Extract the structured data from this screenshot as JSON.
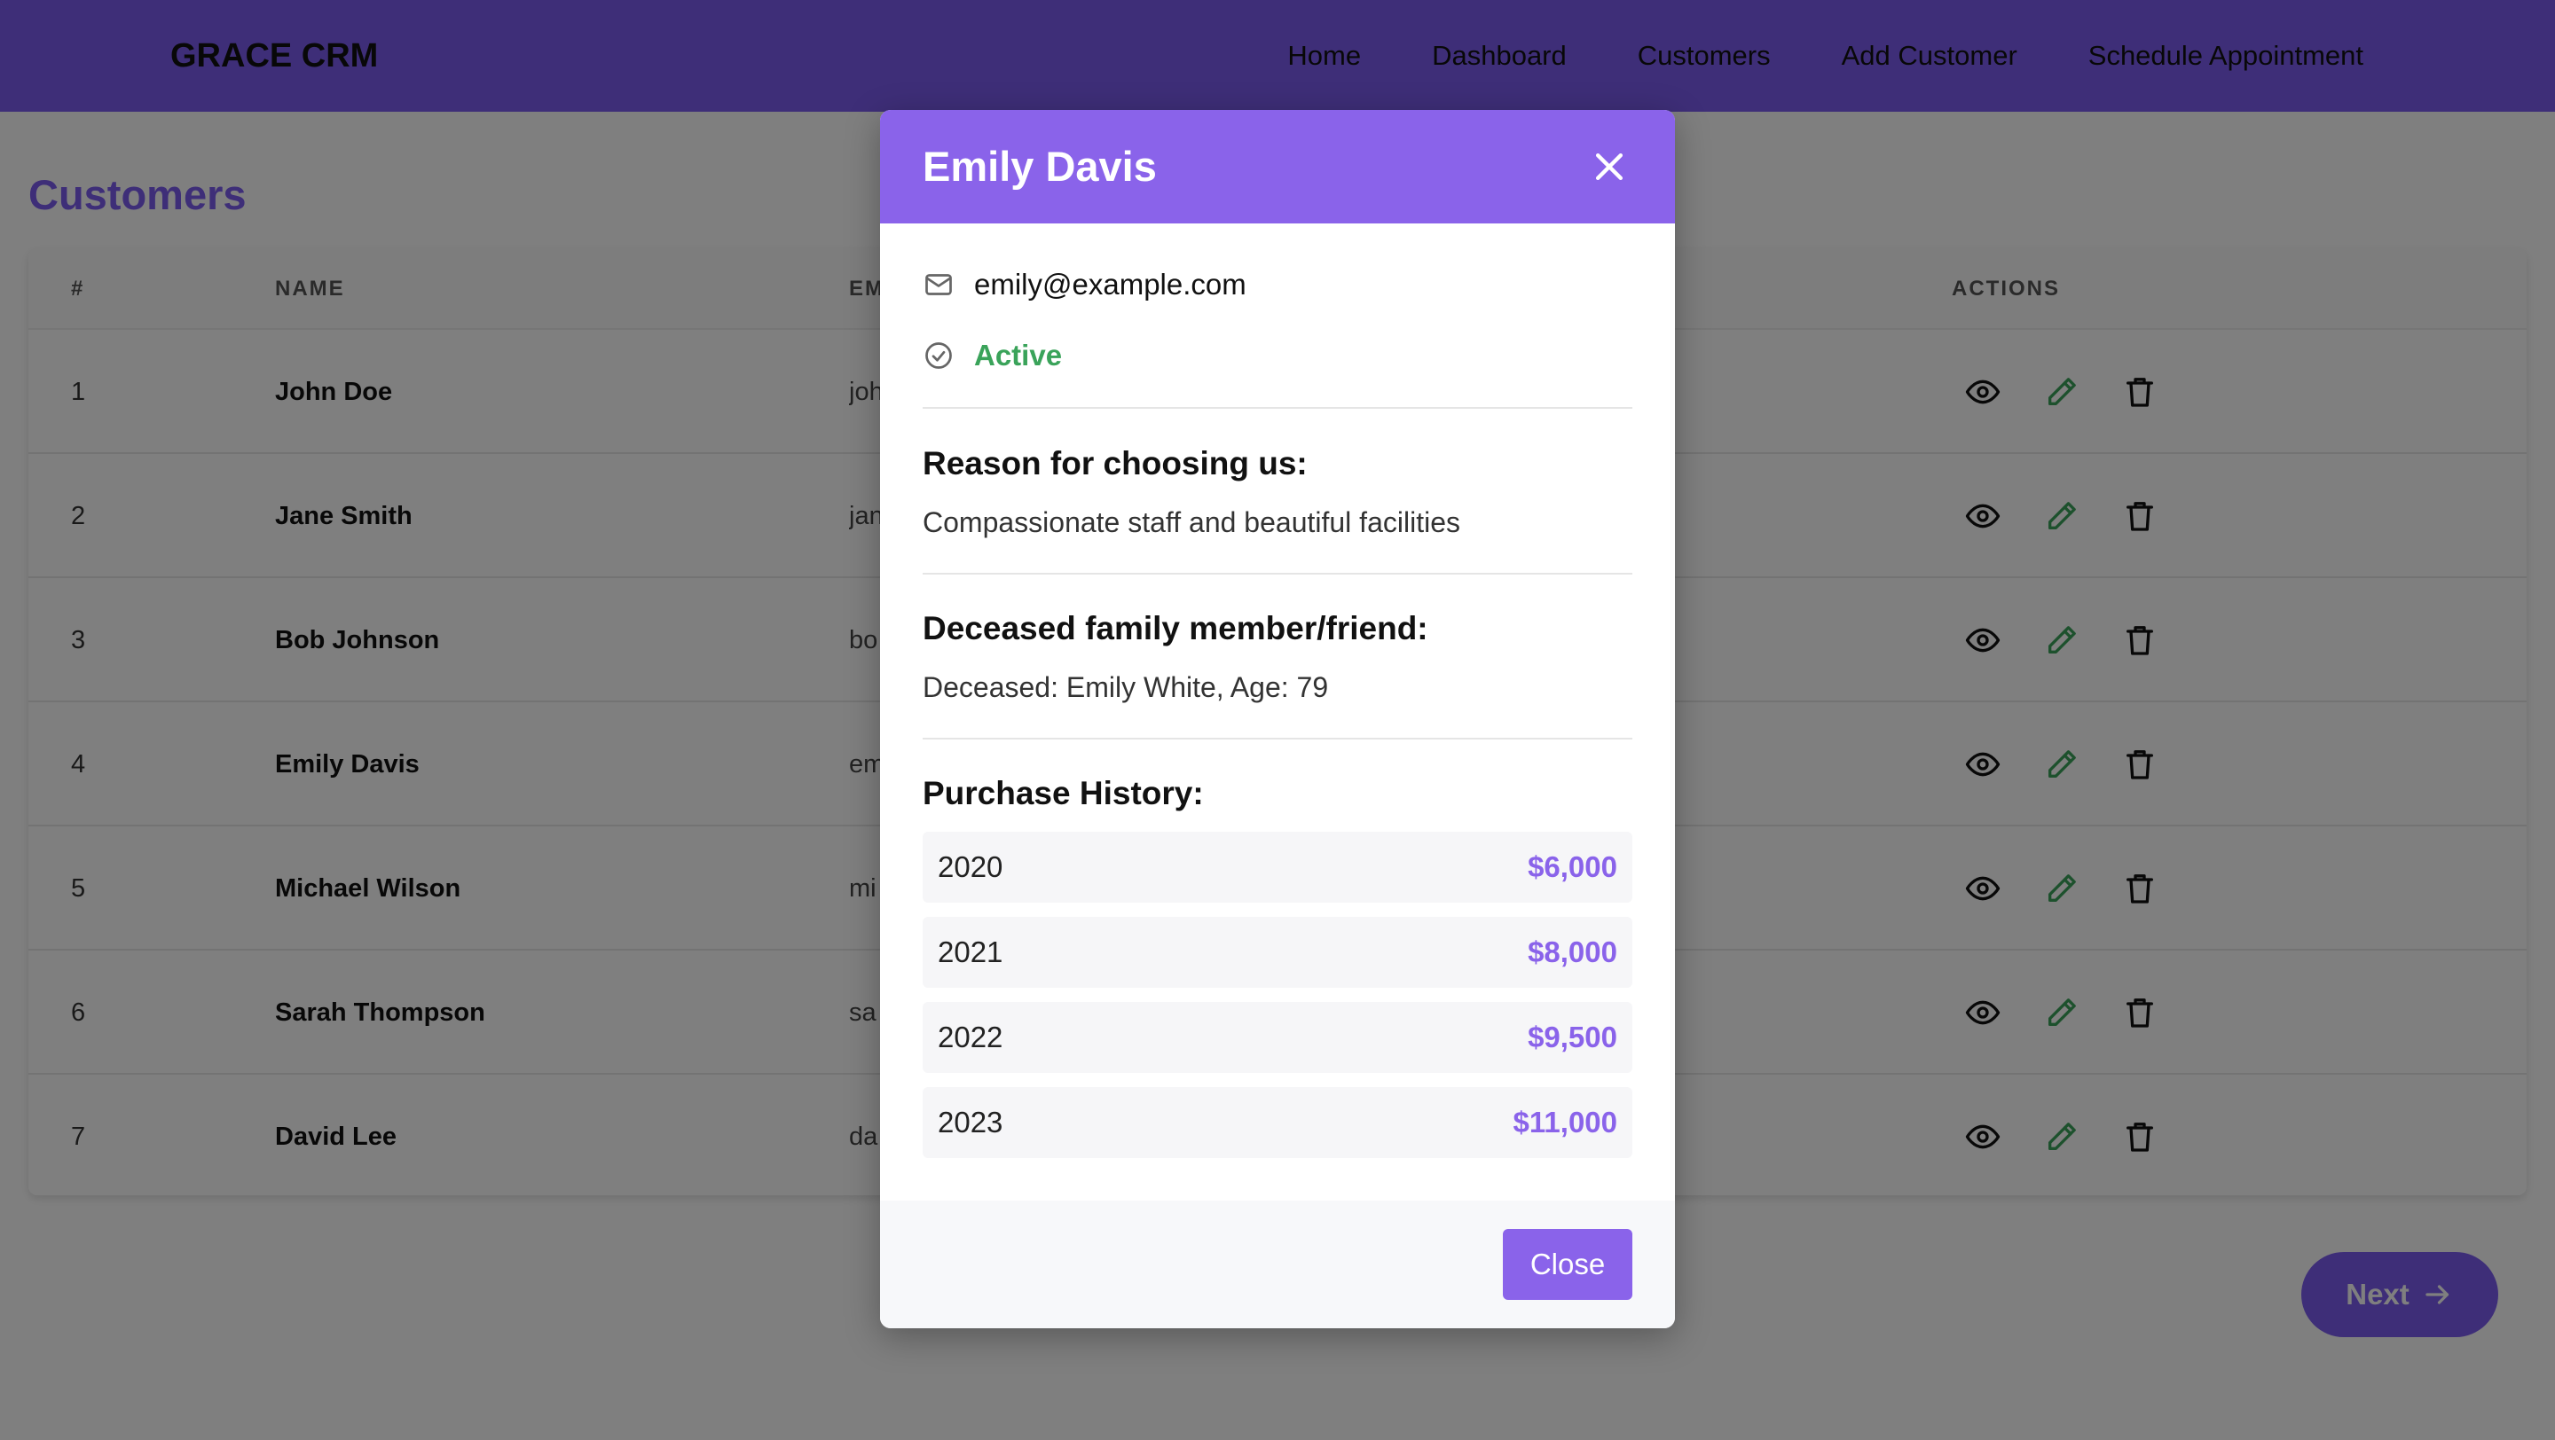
{
  "app": {
    "brand": "GRACE CRM"
  },
  "nav": {
    "items": [
      "Home",
      "Dashboard",
      "Customers",
      "Add Customer",
      "Schedule Appointment"
    ]
  },
  "page": {
    "title": "Customers",
    "next_label": "Next"
  },
  "table": {
    "headers": {
      "num": "#",
      "name": "NAME",
      "email": "EM",
      "actions": "ACTIONS"
    },
    "rows": [
      {
        "num": "1",
        "name": "John Doe",
        "email": "joh"
      },
      {
        "num": "2",
        "name": "Jane Smith",
        "email": "jan"
      },
      {
        "num": "3",
        "name": "Bob Johnson",
        "email": "bo"
      },
      {
        "num": "4",
        "name": "Emily Davis",
        "email": "em"
      },
      {
        "num": "5",
        "name": "Michael Wilson",
        "email": "mi"
      },
      {
        "num": "6",
        "name": "Sarah Thompson",
        "email": "sa"
      },
      {
        "num": "7",
        "name": "David Lee",
        "email": "da"
      }
    ]
  },
  "modal": {
    "title": "Emily Davis",
    "email": "emily@example.com",
    "status": "Active",
    "reason_title": "Reason for choosing us:",
    "reason_text": "Compassionate staff and beautiful facilities",
    "deceased_title": "Deceased family member/friend:",
    "deceased_text": "Deceased: Emily White, Age: 79",
    "purchase_title": "Purchase History:",
    "purchases": [
      {
        "year": "2020",
        "amount": "$6,000"
      },
      {
        "year": "2021",
        "amount": "$8,000"
      },
      {
        "year": "2022",
        "amount": "$9,500"
      },
      {
        "year": "2023",
        "amount": "$11,000"
      }
    ],
    "close_label": "Close"
  },
  "colors": {
    "accent": "#7c5cf0",
    "modal_accent": "#8a63ea",
    "active": "#3aa35a",
    "edit": "#3aa35a"
  },
  "icons": {
    "view": "eye-icon",
    "edit": "pencil-icon",
    "delete": "trash-icon",
    "close": "close-icon",
    "email": "mail-icon",
    "status": "check-circle-icon",
    "next": "arrow-right-icon"
  }
}
